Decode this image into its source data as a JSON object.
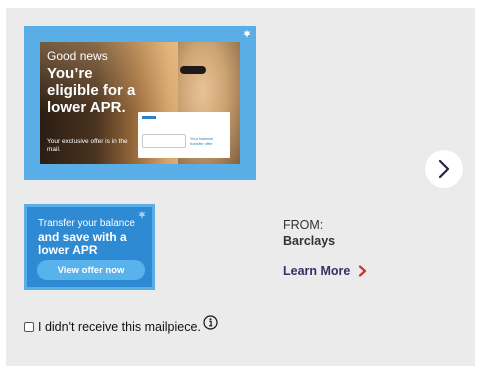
{
  "mailpiece": {
    "image": {
      "eyebrow": "Good news",
      "headline": "You’re eligible for a lower APR.",
      "subtext": "Your exclusive offer is in the mail.",
      "card_caption": "Your balance transfer offer"
    },
    "next_button_icon": "chevron-right-icon",
    "colors": {
      "frame": "#5aaee8",
      "brand_blue": "#2f8ad4",
      "accent_red": "#c8352b",
      "link_navy": "#333366"
    }
  },
  "offer_card": {
    "line1": "Transfer your balance",
    "line2": "and save with a lower APR",
    "button_label": "View offer now"
  },
  "sender": {
    "from_label": "FROM:",
    "name": "Barclays",
    "learn_more": "Learn More"
  },
  "report": {
    "checkbox_label": "I didn't receive this mailpiece.",
    "checked": false,
    "info_icon": "info-icon"
  }
}
